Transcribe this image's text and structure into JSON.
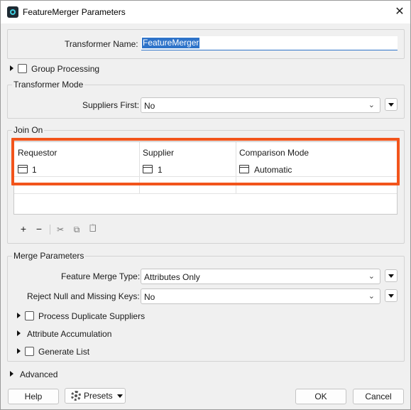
{
  "window": {
    "title": "FeatureMerger Parameters",
    "close_symbol": "✕"
  },
  "transformer_name": {
    "label": "Transformer Name:",
    "value": "FeatureMerger"
  },
  "group_processing": {
    "label": "Group Processing",
    "checked": false
  },
  "transformer_mode": {
    "title": "Transformer Mode",
    "suppliers_first_label": "Suppliers First:",
    "suppliers_first_value": "No"
  },
  "join_on": {
    "title": "Join On",
    "columns": [
      "Requestor",
      "Supplier",
      "Comparison Mode"
    ],
    "rows": [
      {
        "requestor": "1",
        "supplier": "1",
        "comparison_mode": "Automatic"
      }
    ],
    "toolbar": {
      "add": "+",
      "remove": "−",
      "cut": "✂",
      "copy": "⧉",
      "paste": "📋"
    }
  },
  "merge_parameters": {
    "title": "Merge Parameters",
    "feature_merge_type_label": "Feature Merge Type:",
    "feature_merge_type_value": "Attributes Only",
    "reject_null_label": "Reject Null and Missing Keys:",
    "reject_null_value": "No",
    "process_duplicate_label": "Process Duplicate Suppliers",
    "attribute_accumulation_label": "Attribute Accumulation",
    "generate_list_label": "Generate List"
  },
  "advanced": {
    "label": "Advanced"
  },
  "buttons": {
    "help": "Help",
    "presets": "Presets",
    "ok": "OK",
    "cancel": "Cancel"
  },
  "colors": {
    "accent": "#2e73c9",
    "highlight": "#f2541b"
  },
  "icons": {
    "app": "featuremerger-app-icon",
    "combo": "chevron-down-icon",
    "menu": "triangle-down-icon",
    "expander": "triangle-right-icon",
    "attribute": "attribute-value-icon",
    "presets": "gear-icon"
  }
}
